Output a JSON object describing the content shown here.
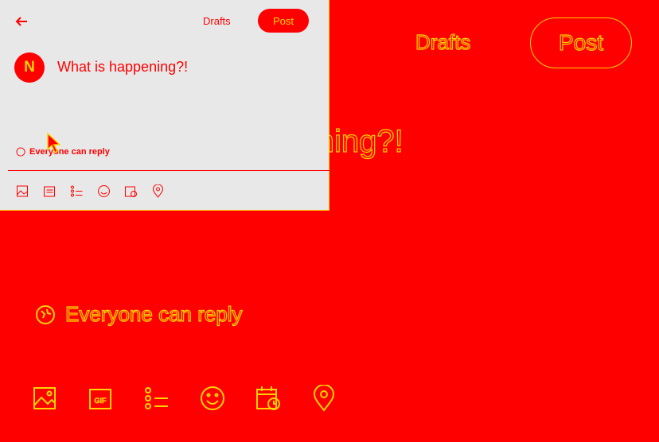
{
  "composer": {
    "drafts_label": "Drafts",
    "post_label": "Post",
    "avatar_initial": "N",
    "prompt_placeholder": "What is happening?!",
    "reply_setting": "Everyone can reply"
  },
  "panel": {
    "drafts_label": "Drafts",
    "post_label": "Post",
    "avatar_initial": "N",
    "prompt_placeholder": "What is happening?!",
    "reply_setting": "Everyone can reply"
  },
  "toolbar_icons": [
    "image-icon",
    "gif-icon",
    "poll-icon",
    "emoji-icon",
    "schedule-icon",
    "location-icon"
  ],
  "colors": {
    "background": "#ff0000",
    "outline": "#ffd400",
    "panel": "#e8e8e8"
  }
}
